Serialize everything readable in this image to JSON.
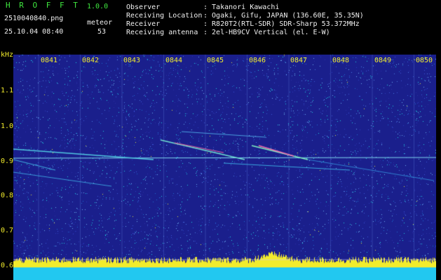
{
  "app": {
    "name": "H R O F F T",
    "version": "1.0.0"
  },
  "file": {
    "name": "2510040840.png",
    "datetime": "25.10.04 08:40"
  },
  "meteor": {
    "label": "meteor",
    "count": "53"
  },
  "info": [
    {
      "label": "Observer",
      "value": ": Takanori Kawachi"
    },
    {
      "label": "Receiving Location",
      "value": ": Ogaki, Gifu, JAPAN (136.60E, 35.35N)"
    },
    {
      "label": "Receiver",
      "value": ": R820T2(RTL-SDR) SDR-Sharp 53.372MHz"
    },
    {
      "label": "Receiving antenna",
      "value": ": 2el-HB9CV Vertical (el. E-W)"
    }
  ],
  "axes": {
    "y_unit": "kHz",
    "x_ticks": [
      "0841",
      "0842",
      "0843",
      "0844",
      "0845",
      "0846",
      "0847",
      "0848",
      "0849",
      "0850"
    ],
    "y_ticks": [
      "1.1",
      "1.0",
      "0.9",
      "0.8",
      "0.7",
      "0.6"
    ]
  },
  "colors": {
    "background": "#1a1f8c",
    "brand": "#3fe83f",
    "ticks": "#f2ec2c",
    "headers": "#f0f0f0"
  }
}
